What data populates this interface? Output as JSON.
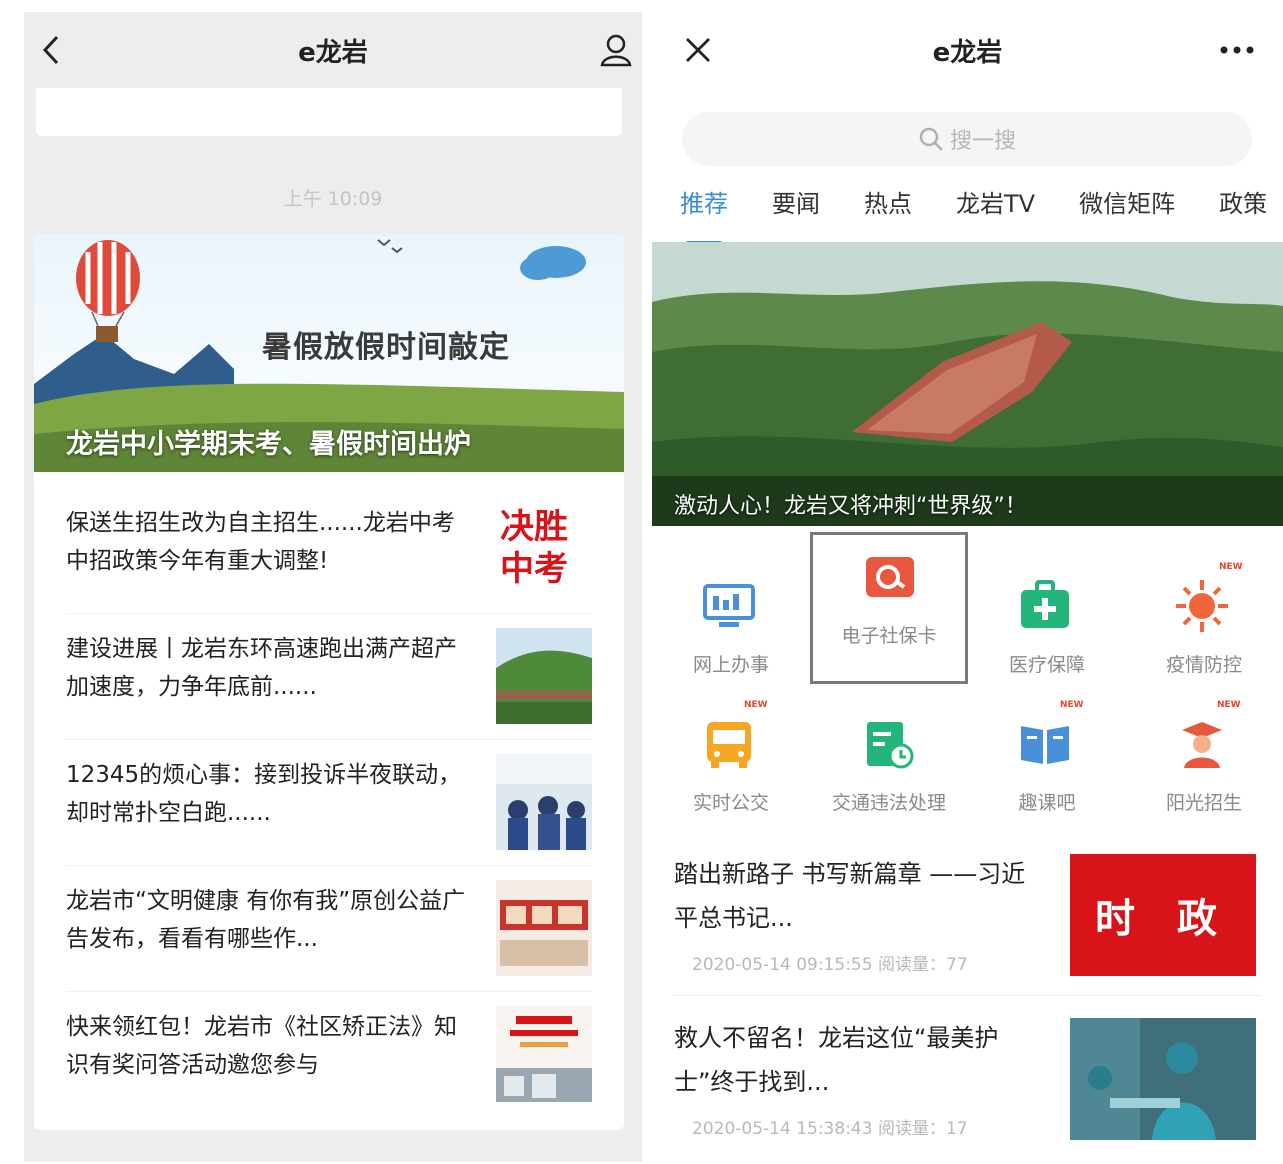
{
  "left": {
    "title": "e龙岩",
    "timestamp": "上午 10:09",
    "hero": {
      "headline": "暑假放假时间敲定",
      "caption": "龙岩中小学期末考、暑假时间出炉"
    },
    "items": [
      {
        "text": "保送生招生改为自主招生......龙岩中考中招政策今年有重大调整!",
        "thumb_text": "决胜中考"
      },
      {
        "text": "建设进展丨龙岩东环高速跑出满产超产加速度，力争年底前......"
      },
      {
        "text": "12345的烦心事：接到投诉半夜联动，却时常扑空白跑......"
      },
      {
        "text": "龙岩市“文明健康 有你有我”原创公益广告发布，看看有哪些作..."
      },
      {
        "text": "快来领红包！龙岩市《社区矫正法》知识有奖问答活动邀您参与"
      }
    ]
  },
  "right": {
    "title": "e龙岩",
    "search_placeholder": "搜一搜",
    "tabs": [
      "推荐",
      "要闻",
      "热点",
      "龙岩TV",
      "微信矩阵",
      "政策"
    ],
    "active_tab": 0,
    "banner_caption": "激动人心！龙岩又将冲刺“世界级”！",
    "services": [
      {
        "label": "网上办事",
        "icon": "computer-icon",
        "color": "#4a90d9",
        "is_new": false
      },
      {
        "label": "电子社保卡",
        "icon": "social-card-icon",
        "color": "#e8583f",
        "is_new": false
      },
      {
        "label": "医疗保障",
        "icon": "medical-kit-icon",
        "color": "#23b57a",
        "is_new": false
      },
      {
        "label": "疫情防控",
        "icon": "virus-icon",
        "color": "#f0663a",
        "is_new": true
      },
      {
        "label": "实时公交",
        "icon": "bus-icon",
        "color": "#f5a623",
        "is_new": true
      },
      {
        "label": "交通违法处理",
        "icon": "traffic-icon",
        "color": "#23b57a",
        "is_new": false
      },
      {
        "label": "趣课吧",
        "icon": "book-icon",
        "color": "#4a90d9",
        "is_new": true
      },
      {
        "label": "阳光招生",
        "icon": "graduate-icon",
        "color": "#e8583f",
        "is_new": true
      }
    ],
    "new_badge": "NEW",
    "news": [
      {
        "title": "踏出新路子 书写新篇章 ——习近平总书记...",
        "meta": "2020-05-14 09:15:55   阅读量：77",
        "thumb_text": "时 政"
      },
      {
        "title": "救人不留名！龙岩这位“最美护士”终于找到...",
        "meta": "2020-05-14 15:38:43   阅读量：17"
      }
    ]
  },
  "colors": {
    "accent": "#3a8bd8",
    "red": "#d8141a"
  }
}
